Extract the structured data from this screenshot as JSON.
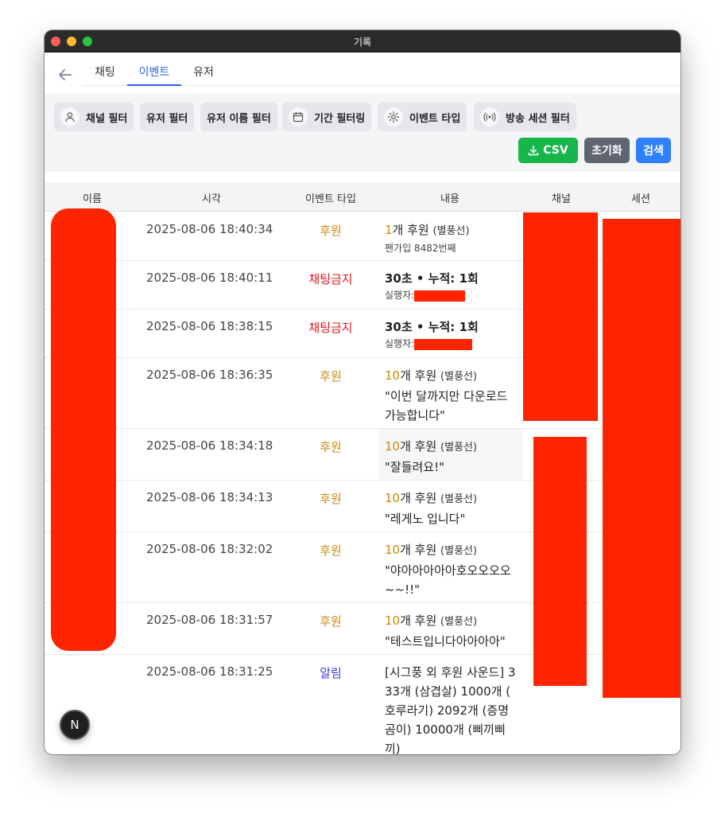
{
  "window": {
    "title": "기록"
  },
  "tabs": [
    {
      "label": "채팅",
      "active": false
    },
    {
      "label": "이벤트",
      "active": true
    },
    {
      "label": "유저",
      "active": false
    }
  ],
  "filters": [
    {
      "label": "채널 필터",
      "icon": "user-icon"
    },
    {
      "label": "유저 필터",
      "icon": ""
    },
    {
      "label": "유저 이름 필터",
      "icon": ""
    },
    {
      "label": "기간 필터링",
      "icon": "calendar-icon"
    },
    {
      "label": "이벤트 타입",
      "icon": "gear-icon"
    },
    {
      "label": "방송 세션 필터",
      "icon": "broadcast-icon"
    }
  ],
  "actions": {
    "csv": {
      "label": "CSV",
      "color": "#16b64a",
      "icon": "download-icon"
    },
    "reset": {
      "label": "초기화",
      "color": "#5f6670"
    },
    "search": {
      "label": "검색",
      "color": "#2f80ff"
    }
  },
  "table": {
    "headers": [
      "이름",
      "시각",
      "이벤트 타입",
      "내용",
      "채널",
      "세션"
    ],
    "rows": [
      {
        "time": "2025-08-06 18:40:34",
        "type": "후원",
        "type_color": "#c58a09",
        "count": "1",
        "count_suffix": "개 후원",
        "item": "(별풍선)",
        "line2": "팬가입 8482번째"
      },
      {
        "time": "2025-08-06 18:40:11",
        "type": "채팅금지",
        "type_color": "#e0141e",
        "text": "30초 • 누적: 1회",
        "executor_label": "실행자:"
      },
      {
        "time": "2025-08-06 18:38:15",
        "type": "채팅금지",
        "type_color": "#e0141e",
        "text": "30초 • 누적: 1회",
        "executor_label": "실행자:"
      },
      {
        "time": "2025-08-06 18:36:35",
        "type": "후원",
        "type_color": "#c58a09",
        "count": "10",
        "count_suffix": "개 후원",
        "item": "(별풍선)",
        "message": "\"이번 달까지만 다운로드 가능합니다\""
      },
      {
        "time": "2025-08-06 18:34:18",
        "type": "후원",
        "type_color": "#c58a09",
        "count": "10",
        "count_suffix": "개 후원",
        "item": "(별풍선)",
        "message": "\"잘들려요!\""
      },
      {
        "time": "2025-08-06 18:34:13",
        "type": "후원",
        "type_color": "#c58a09",
        "count": "10",
        "count_suffix": "개 후원",
        "item": "(별풍선)",
        "message": "\"레게노 입니다\""
      },
      {
        "time": "2025-08-06 18:32:02",
        "type": "후원",
        "type_color": "#c58a09",
        "count": "10",
        "count_suffix": "개 후원",
        "item": "(별풍선)",
        "message": "\"야아아아아아호오오오오~~!!\""
      },
      {
        "time": "2025-08-06 18:31:57",
        "type": "후원",
        "type_color": "#c58a09",
        "count": "10",
        "count_suffix": "개 후원",
        "item": "(별풍선)",
        "message": "\"테스트입니다아아아아\""
      },
      {
        "time": "2025-08-06 18:31:25",
        "type": "알림",
        "type_color": "#3b3bd6",
        "message": "[시그풍 외 후원 사운드] 3 33개 (삼겹살) 1000개 ( 호루라기) 2092개 (증명 곰이) 10000개 (삐끼삐 끼)"
      }
    ]
  },
  "badge": {
    "label": "N"
  }
}
